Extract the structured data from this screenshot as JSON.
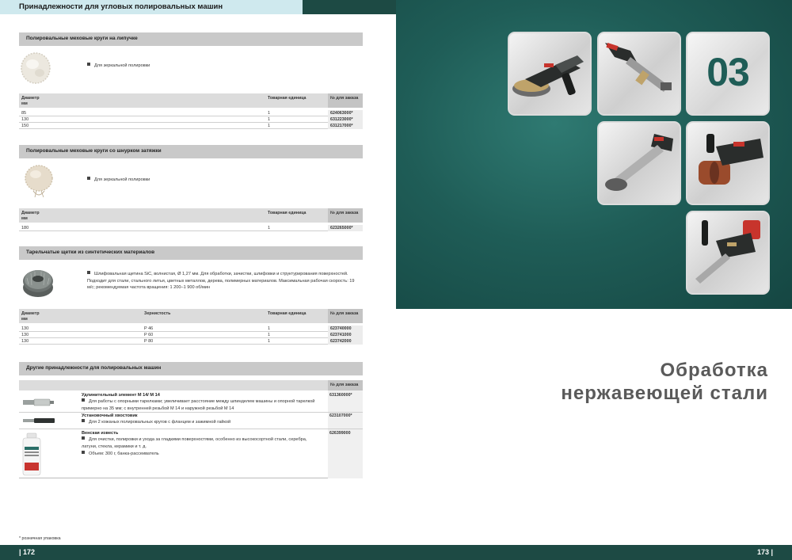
{
  "left_page": {
    "header_title": "Принадлежности для угловых полировальных машин",
    "page_number": "| 172",
    "footnote": "* розничная упаковка",
    "sections": [
      {
        "title": "Полировальные меховые круги на липучке",
        "bullets": [
          "Для зеркальной полировки"
        ],
        "columns": [
          "Диаметр\nмм",
          "Товарная единица",
          "№ для заказа"
        ],
        "rows": [
          {
            "diameter": "85",
            "unit": "1",
            "order": "624063000*"
          },
          {
            "diameter": "130",
            "unit": "1",
            "order": "631223000*"
          },
          {
            "diameter": "150",
            "unit": "1",
            "order": "631217000*"
          }
        ]
      },
      {
        "title": "Полировальные меховые круги со шнурком затяжки",
        "bullets": [
          "Для зеркальной полировки"
        ],
        "columns": [
          "Диаметр\nмм",
          "Товарная единица",
          "№ для заказа"
        ],
        "rows": [
          {
            "diameter": "180",
            "unit": "1",
            "order": "623265000*"
          }
        ]
      },
      {
        "title": "Тарельчатые щетки из синтетических материалов",
        "bullets": [
          "Шлифовальная щетина SiC, волнистая, Ø 1,27 мм. Для обработки, зачистки, шлифовки и структурирования поверхностей. Подходит для стали, стального литья, цветных металлов, дерева, полимерных материалов. Максимальная рабочая скорость: 19 м/с; рекомендуемая частота вращения: 1 200–1 900 об/мин"
        ],
        "columns": [
          "Диаметр\nмм",
          "Зернистость",
          "Товарная единица",
          "№ для заказа"
        ],
        "rows": [
          {
            "diameter": "130",
            "grit": "P 46",
            "unit": "1",
            "order": "623740000"
          },
          {
            "diameter": "130",
            "grit": "P 60",
            "unit": "1",
            "order": "623741000"
          },
          {
            "diameter": "130",
            "grit": "P 80",
            "unit": "1",
            "order": "623742000"
          }
        ]
      },
      {
        "title": "Другие принадлежности для полировальных машин",
        "order_header": "№ для заказа",
        "items": [
          {
            "name": "Удлинительный элемент M 14/ M 14",
            "bullets": [
              "Для работы с опорными тарелками; увеличивает расстояние между шпинделем машины и опорной тарелкой примерно на 35 мм; с внутренней резьбой M 14 и наружной резьбой M 14"
            ],
            "order": "631360000*"
          },
          {
            "name": "Установочный хвостовик",
            "bullets": [
              "Для 2 кожаных полировальных кругов с фланцем и зажимной гайкой"
            ],
            "order": "623107000*"
          },
          {
            "name": "Венская известь",
            "bullets": [
              "Для очистки, полировки и ухода за гладкими поверхностями, особенно из высокосортной стали, серебра, латуни, стекла, керамики и т. д.",
              "Объем: 300 г, банка-рассеиватель"
            ],
            "order": "626399000"
          }
        ]
      }
    ]
  },
  "right_page": {
    "chapter_number": "03",
    "headline_line1": "Обработка",
    "headline_line2": "нержавеющей стали",
    "page_number": "173 |"
  },
  "colors": {
    "dark_green": "#1d4a44",
    "header_tab": "#cfe9ee",
    "teal_bg": "#1f5d57",
    "section_bar": "#c9c9c9"
  }
}
